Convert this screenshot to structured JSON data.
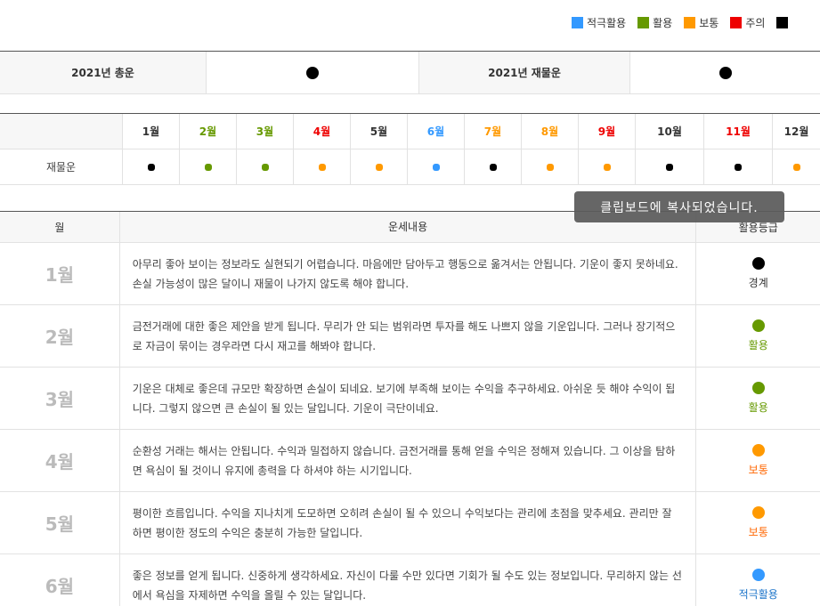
{
  "legend": [
    {
      "label": "적극활용",
      "color": "#3399ff"
    },
    {
      "label": "활용",
      "color": "#669900"
    },
    {
      "label": "보통",
      "color": "#ff9900"
    },
    {
      "label": "주의",
      "color": "#ee0000"
    },
    {
      "label": "",
      "color": "#000000"
    }
  ],
  "summary": {
    "total_label": "2021년 총운",
    "total_color": "#000000",
    "wealth_label": "2021년 재물운",
    "wealth_color": "#000000"
  },
  "months_grid": {
    "row_label": "재물운",
    "months": [
      {
        "label": "1월",
        "label_color": "#333333",
        "dot_color": "#000000"
      },
      {
        "label": "2월",
        "label_color": "#669900",
        "dot_color": "#669900"
      },
      {
        "label": "3월",
        "label_color": "#669900",
        "dot_color": "#669900"
      },
      {
        "label": "4월",
        "label_color": "#ee0000",
        "dot_color": "#ff9900"
      },
      {
        "label": "5월",
        "label_color": "#333333",
        "dot_color": "#ff9900"
      },
      {
        "label": "6월",
        "label_color": "#3399ff",
        "dot_color": "#3399ff"
      },
      {
        "label": "7월",
        "label_color": "#ff9900",
        "dot_color": "#000000"
      },
      {
        "label": "8월",
        "label_color": "#ff9900",
        "dot_color": "#ff9900"
      },
      {
        "label": "9월",
        "label_color": "#ee0000",
        "dot_color": "#ff9900"
      },
      {
        "label": "10월",
        "label_color": "#333333",
        "dot_color": "#000000"
      },
      {
        "label": "11월",
        "label_color": "#ee0000",
        "dot_color": "#000000"
      },
      {
        "label": "12월",
        "label_color": "#333333",
        "dot_color": "#ff9900"
      }
    ]
  },
  "fortune": {
    "headers": {
      "month": "월",
      "content": "운세내용",
      "grade": "활용등급"
    },
    "rows": [
      {
        "month": "1월",
        "content": "아무리 좋아 보이는 정보라도 실현되기 어렵습니다. 마음에만 담아두고 행동으로 옮겨서는 안됩니다. 기운이 좋지 못하네요. 손실 가능성이 많은 달이니 재물이 나가지 않도록 해야 합니다.",
        "grade": "경계",
        "grade_color": "#000000",
        "grade_text_color": "#333333"
      },
      {
        "month": "2월",
        "content": "금전거래에 대한 좋은 제안을 받게 됩니다. 무리가 안 되는 범위라면 투자를 해도 나쁘지 않을 기운입니다. 그러나 장기적으로 자금이 묶이는 경우라면 다시 재고를 해봐야 합니다.",
        "grade": "활용",
        "grade_color": "#669900",
        "grade_text_color": "#669900"
      },
      {
        "month": "3월",
        "content": "기운은 대체로 좋은데 규모만 확장하면 손실이 되네요. 보기에 부족해 보이는 수익을 추구하세요. 아쉬운 듯 해야 수익이 됩니다. 그렇지 않으면 큰 손실이 될 있는 달입니다. 기운이 극단이네요.",
        "grade": "활용",
        "grade_color": "#669900",
        "grade_text_color": "#669900"
      },
      {
        "month": "4월",
        "content": "순환성 거래는 해서는 안됩니다. 수익과 밀접하지 않습니다. 금전거래를 통해 얻을 수익은 정해져 있습니다. 그 이상을 탐하면 욕심이 될 것이니 유지에 총력을 다 하셔야 하는 시기입니다.",
        "grade": "보통",
        "grade_color": "#ff9900",
        "grade_text_color": "#ff6600"
      },
      {
        "month": "5월",
        "content": "평이한 흐름입니다. 수익을 지나치게 도모하면 오히려 손실이 될 수 있으니 수익보다는 관리에 초점을 맞추세요. 관리만 잘 하면 평이한 정도의 수익은 충분히 가능한 달입니다.",
        "grade": "보통",
        "grade_color": "#ff9900",
        "grade_text_color": "#ff6600"
      },
      {
        "month": "6월",
        "content": "좋은 정보를 얻게 됩니다. 신중하게 생각하세요. 자신이 다룰 수만 있다면 기회가 될 수도 있는 정보입니다. 무리하지 않는 선에서 욕심을 자제하면 수익을 올릴 수 있는 달입니다.",
        "grade": "적극활용",
        "grade_color": "#3399ff",
        "grade_text_color": "#1a73c9"
      }
    ]
  },
  "toast": {
    "text": "클립보드에 복사되었습니다."
  }
}
